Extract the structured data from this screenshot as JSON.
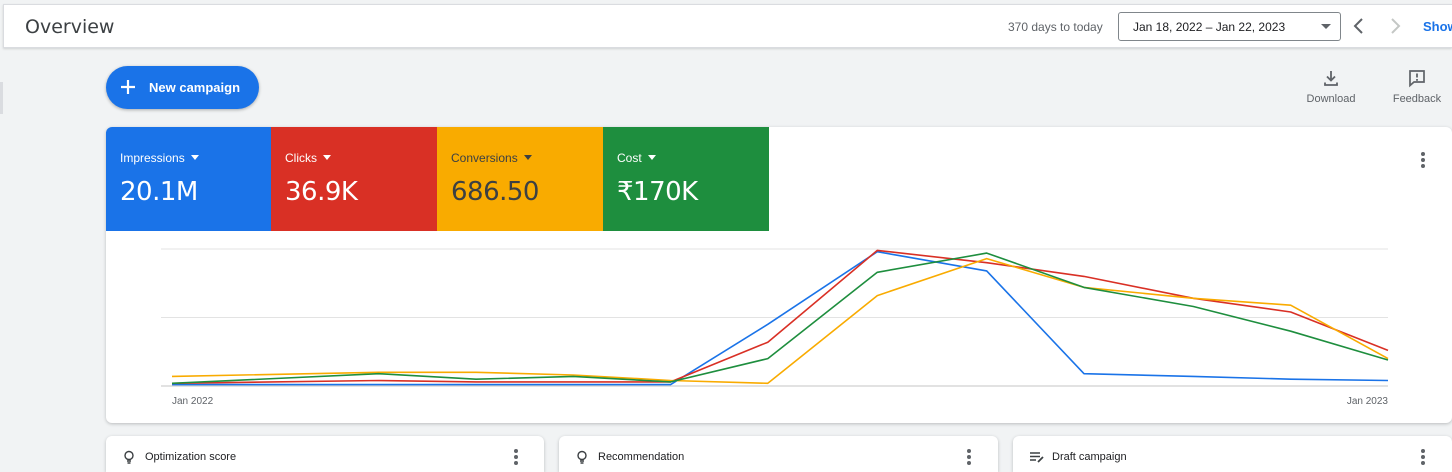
{
  "header": {
    "title": "Overview",
    "days_text": "370 days to today",
    "date_range": "Jan 18, 2022 – Jan 22, 2023",
    "show_label": "Show"
  },
  "actions": {
    "new_campaign": "New campaign",
    "download": "Download",
    "feedback": "Feedback"
  },
  "metrics": [
    {
      "name": "Impressions",
      "value": "20.1M",
      "color": "#1a73e8"
    },
    {
      "name": "Clicks",
      "value": "36.9K",
      "color": "#d93025"
    },
    {
      "name": "Conversions",
      "value": "686.50",
      "color": "#f9ab00"
    },
    {
      "name": "Cost",
      "value": "₹170K",
      "color": "#1e8e3e"
    }
  ],
  "chart_data": {
    "type": "line",
    "x_labels": [
      "Jan 2022",
      "Jan 2023"
    ],
    "y_range": [
      0,
      100
    ],
    "gridlines": 3,
    "grid": true,
    "legend": "none",
    "series": [
      {
        "color": "#1a73e8",
        "points": [
          [
            0,
            1
          ],
          [
            0.17,
            1
          ],
          [
            0.25,
            1
          ],
          [
            0.41,
            1
          ],
          [
            0.49,
            45
          ],
          [
            0.58,
            98
          ],
          [
            0.67,
            84
          ],
          [
            0.75,
            9
          ],
          [
            0.84,
            7
          ],
          [
            0.92,
            5
          ],
          [
            1,
            4
          ]
        ]
      },
      {
        "color": "#d93025",
        "points": [
          [
            0,
            2
          ],
          [
            0.17,
            4
          ],
          [
            0.25,
            3
          ],
          [
            0.33,
            3
          ],
          [
            0.41,
            3
          ],
          [
            0.49,
            32
          ],
          [
            0.58,
            99
          ],
          [
            0.67,
            90
          ],
          [
            0.75,
            80
          ],
          [
            0.84,
            64
          ],
          [
            0.92,
            54
          ],
          [
            1,
            26
          ]
        ]
      },
      {
        "color": "#f9ab00",
        "points": [
          [
            0,
            7
          ],
          [
            0.17,
            10
          ],
          [
            0.25,
            10
          ],
          [
            0.33,
            8
          ],
          [
            0.41,
            4
          ],
          [
            0.49,
            2
          ],
          [
            0.58,
            66
          ],
          [
            0.67,
            93
          ],
          [
            0.75,
            72
          ],
          [
            0.84,
            64
          ],
          [
            0.92,
            59
          ],
          [
            1,
            20
          ]
        ]
      },
      {
        "color": "#1e8e3e",
        "points": [
          [
            0,
            2
          ],
          [
            0.17,
            9
          ],
          [
            0.25,
            5
          ],
          [
            0.33,
            7
          ],
          [
            0.41,
            3
          ],
          [
            0.49,
            20
          ],
          [
            0.58,
            83
          ],
          [
            0.67,
            97
          ],
          [
            0.75,
            72
          ],
          [
            0.84,
            58
          ],
          [
            0.92,
            40
          ],
          [
            1,
            19
          ]
        ]
      }
    ]
  },
  "bottom_cards": [
    {
      "label": "Optimization score",
      "icon": "lightbulb-icon"
    },
    {
      "label": "Recommendation",
      "icon": "lightbulb-icon"
    },
    {
      "label": "Draft campaign",
      "icon": "draft-list-icon"
    }
  ]
}
